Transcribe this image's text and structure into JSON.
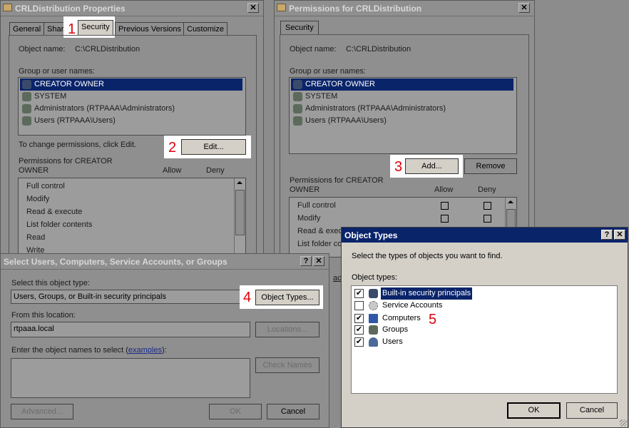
{
  "win1": {
    "title": "CRLDistribution Properties",
    "close": "✕",
    "tabs": [
      "General",
      "Shari",
      "Security",
      "Previous Versions",
      "Customize"
    ],
    "object_name_label": "Object name:",
    "object_name_value": "C:\\CRLDistribution",
    "group_label": "Group or user names:",
    "users": [
      "CREATOR OWNER",
      "SYSTEM",
      "Administrators (RTPAAA\\Administrators)",
      "Users (RTPAAA\\Users)"
    ],
    "change_text": "To change permissions, click Edit.",
    "edit_button": "Edit...",
    "perm_label_1": "Permissions for CREATOR",
    "perm_label_2": "OWNER",
    "allow": "Allow",
    "deny": "Deny",
    "permissions": [
      "Full control",
      "Modify",
      "Read & execute",
      "List folder contents",
      "Read",
      "Write"
    ]
  },
  "win2": {
    "title": "Permissions for CRLDistribution",
    "close": "✕",
    "tab": "Security",
    "object_name_label": "Object name:",
    "object_name_value": "C:\\CRLDistribution",
    "group_label": "Group or user names:",
    "users": [
      "CREATOR OWNER",
      "SYSTEM",
      "Administrators (RTPAAA\\Administrators)",
      "Users (RTPAAA\\Users)"
    ],
    "add_button": "Add...",
    "remove_button": "Remove",
    "perm_label_1": "Permissions for CREATOR",
    "perm_label_2": "OWNER",
    "allow": "Allow",
    "deny": "Deny",
    "permissions": [
      "Full control",
      "Modify",
      "Read & exec",
      "List folder co"
    ],
    "partial_link": "ac"
  },
  "win3": {
    "title": "Select Users, Computers, Service Accounts, or Groups",
    "help": "?",
    "close": "✕",
    "object_type_label": "Select this object type:",
    "object_type_value": "Users, Groups, or Built-in security principals",
    "object_types_button": "Object Types...",
    "location_label": "From this location:",
    "location_value": "rtpaaa.local",
    "locations_button": "Locations...",
    "enter_label": "Enter the object names to select (",
    "enter_link": "examples",
    "enter_label_end": "):",
    "check_names_button": "Check Names",
    "advanced_button": "Advanced...",
    "ok_button": "OK",
    "cancel_button": "Cancel"
  },
  "win4": {
    "title": "Object Types",
    "help": "?",
    "close": "✕",
    "instruction": "Select the types of objects you want to find.",
    "types_label": "Object types:",
    "types": [
      {
        "label": "Built-in security principals",
        "checked": true,
        "mark": "✔"
      },
      {
        "label": "Service Accounts",
        "checked": false,
        "mark": ""
      },
      {
        "label": "Computers",
        "checked": true,
        "mark": "✔"
      },
      {
        "label": "Groups",
        "checked": true,
        "mark": "✔"
      },
      {
        "label": "Users",
        "checked": true,
        "mark": "✔"
      }
    ],
    "ok_button": "OK",
    "cancel_button": "Cancel"
  },
  "steps": [
    "1",
    "2",
    "3",
    "4",
    "5"
  ]
}
